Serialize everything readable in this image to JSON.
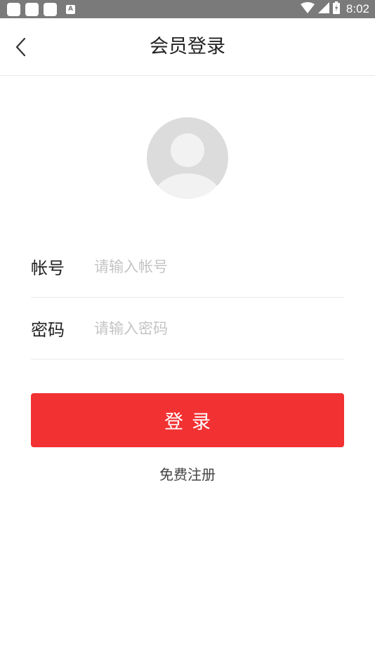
{
  "status_bar": {
    "time": "8:02",
    "left_icons": [
      "app-icon",
      "app-icon",
      "app-icon",
      "a-icon"
    ],
    "a_glyph": "A",
    "right_icons": [
      "wifi-icon",
      "signal-icon",
      "battery-icon"
    ]
  },
  "header": {
    "title": "会员登录",
    "back_icon": "chevron-left-icon"
  },
  "avatar": {
    "icon": "user-avatar-icon"
  },
  "form": {
    "account": {
      "label": "帐号",
      "placeholder": "请输入帐号",
      "value": ""
    },
    "password": {
      "label": "密码",
      "placeholder": "请输入密码",
      "value": ""
    }
  },
  "actions": {
    "login_label": "登录",
    "register_label": "免费注册"
  },
  "colors": {
    "status_bar_bg": "#7a7a7a",
    "accent": "#f23132",
    "avatar_bg": "#dcdcdc",
    "avatar_fg": "#f2f2f2"
  }
}
